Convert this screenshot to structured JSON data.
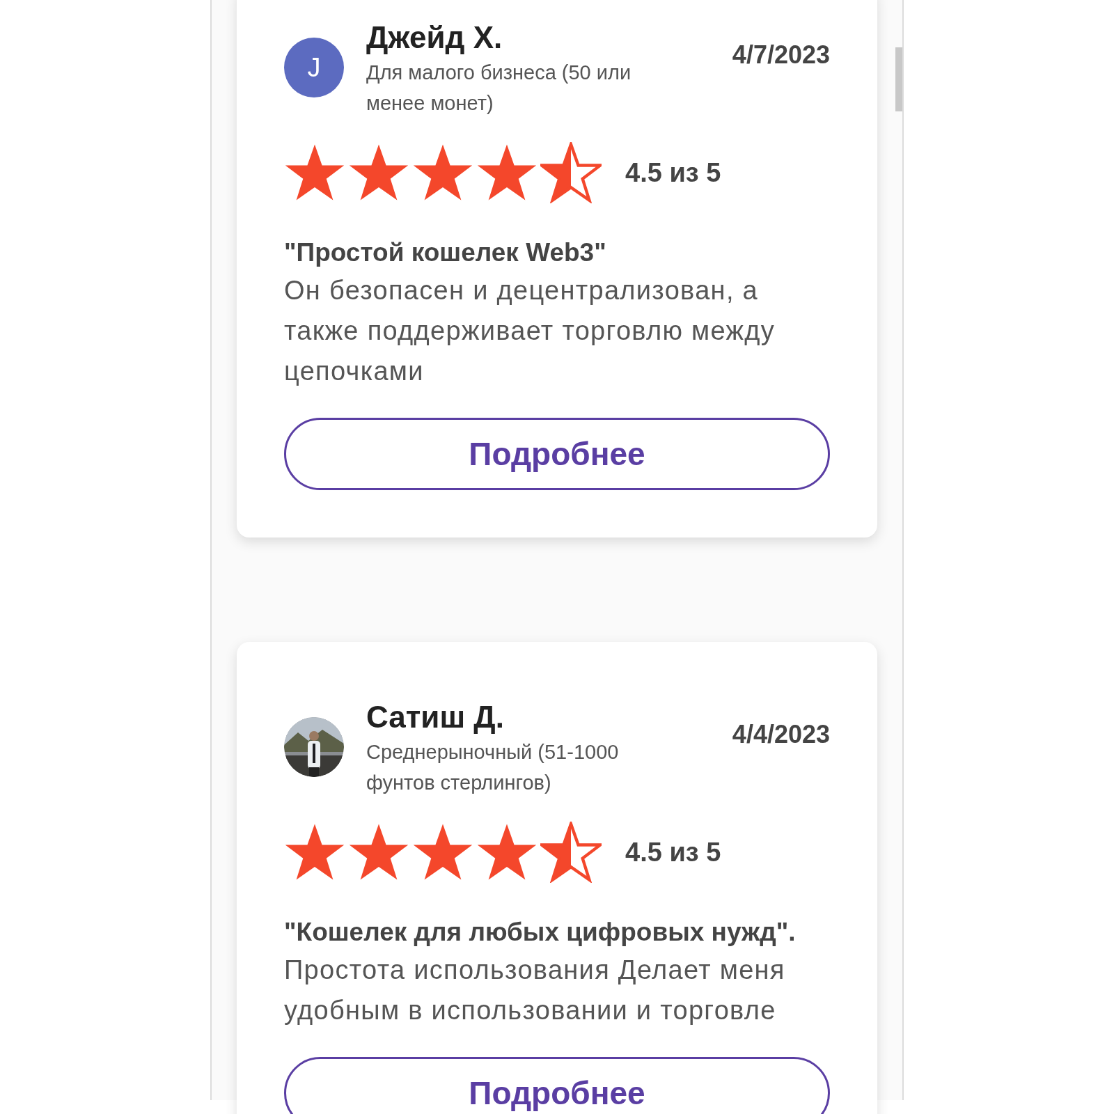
{
  "reviews": [
    {
      "avatar": {
        "kind": "letter",
        "letter": "J",
        "color": "#5c6bc0"
      },
      "name": "Джейд Х.",
      "segment": "Для малого бизнеса (50 или менее монет)",
      "date": "4/7/2023",
      "stars": 4.5,
      "rating_text": "4.5 из 5",
      "title": "\"Простой кошелек Web3\"",
      "body": "Он безопасен и децентрализован, а также поддерживает торговлю между цепочками",
      "button": "Подробнее"
    },
    {
      "name": "Сатиш Д.",
      "segment": "Среднерыночный (51-1000 фунтов стерлингов)",
      "date": "4/4/2023",
      "stars": 4.5,
      "rating_text": "4.5 из 5",
      "title": "\"Кошелек для любых цифровых нужд\".",
      "body": "Простота использования Делает меня удобным в использовании и торговле",
      "button": "Подробнее"
    }
  ]
}
